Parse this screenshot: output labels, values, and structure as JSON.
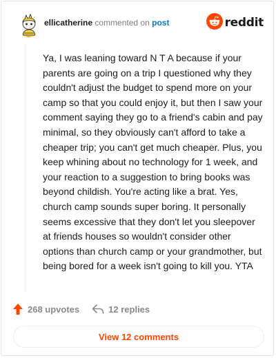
{
  "comment": {
    "username": "ellicatherine",
    "action_text": "commented on",
    "post_link": "post",
    "avatar_icon": "snoo-avatar-icon",
    "body": "Ya, I was leaning toward N T A because if your parents are going on a trip I questioned why they couldn't adjust the budget to spend more on your camp so that you could enjoy it, but then I saw your comment saying they go to a friend's cabin and pay minimal, so they obviously can't afford to take a cheaper trip; you can't get much cheaper. Plus, you keep whining about no technology for 1 week, and your reaction to a suggestion to bring books was beyond childish. You're acting like a brat. Yes, church camp sounds super boring. It personally seems excessive that they don't let you sleepover at friends houses so wouldn't consider other options than church camp or your grandmother, but being bored for a week isn't going to kill you. YTA",
    "upvotes_label": "268 upvotes",
    "replies_label": "12 replies",
    "view_comments_label": "View 12 comments"
  },
  "brand": {
    "name": "reddit",
    "icon": "reddit-logo-icon",
    "accent_color": "#ff4500",
    "link_color": "#0079d3"
  },
  "icons": {
    "upvote": "upvote-arrow-icon",
    "reply": "reply-arrow-icon"
  }
}
